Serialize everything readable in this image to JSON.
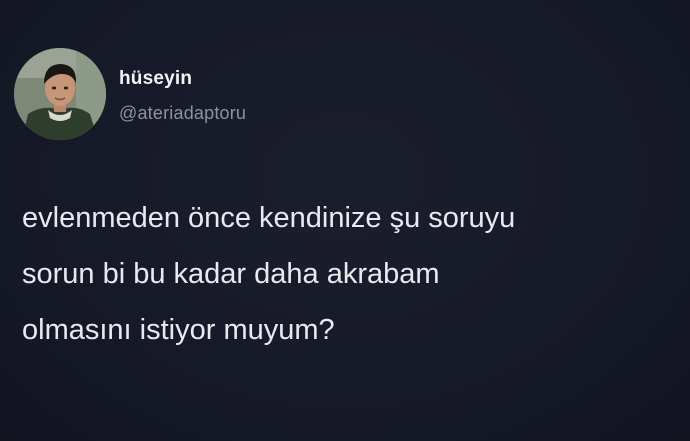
{
  "author": {
    "display_name": "hüseyin",
    "handle": "@ateriadaptoru",
    "avatar_icon": "profile-photo"
  },
  "tweet": {
    "lines": [
      "evlenmeden önce kendinize şu soruyu",
      "sorun bi bu kadar daha akrabam",
      "olmasını istiyor muyum?"
    ]
  },
  "colors": {
    "background": "#161927",
    "text": "#e8eaef",
    "handle": "#8d93a3"
  }
}
